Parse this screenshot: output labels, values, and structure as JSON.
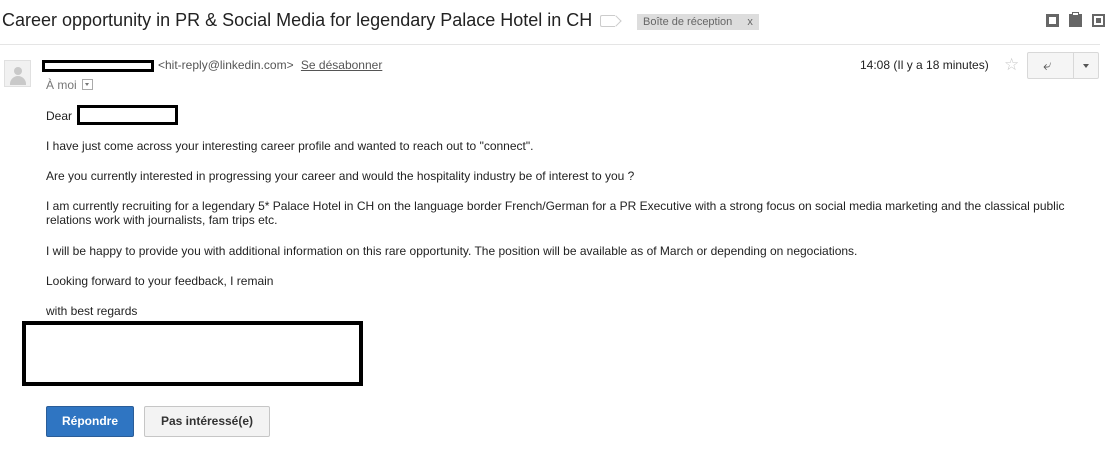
{
  "header": {
    "subject": "Career opportunity in PR & Social Media for legendary Palace Hotel in CH",
    "inbox_label": "Boîte de réception",
    "inbox_label_remove": "x",
    "icons": [
      "collapse-icon",
      "print-icon",
      "new-window-icon"
    ]
  },
  "message": {
    "sender_email": "<hit-reply@linkedin.com>",
    "unsubscribe": "Se désabonner",
    "to": "À moi",
    "time": "14:08 (Il y a 18 minutes)",
    "star": "☆",
    "reply_icon": "reply-icon",
    "more_icon": "dropdown-icon"
  },
  "body": {
    "greeting": "Dear",
    "p1": "I have just come across your interesting career profile and wanted to reach out to \"connect\".",
    "p2": "Are you currently interested in progressing your career and would the hospitality industry be of interest to you ?",
    "p3": "I am currently recruiting for a legendary 5* Palace Hotel in CH on the language border French/German for a PR Executive with a strong focus on social media marketing and the classical public relations work with journalists, fam trips etc.",
    "p4": "I will be happy to provide you with additional information on this rare opportunity. The position will be available as of March or depending on negociations.",
    "p5": "Looking forward to your feedback, I remain",
    "p6": "with best regards"
  },
  "actions": {
    "reply": "Répondre",
    "not_interested": "Pas intéressé(e)"
  },
  "colors": {
    "primary_button": "#2f75c2",
    "secondary_button": "#f3f3f3",
    "chip_bg": "#dddddd"
  }
}
